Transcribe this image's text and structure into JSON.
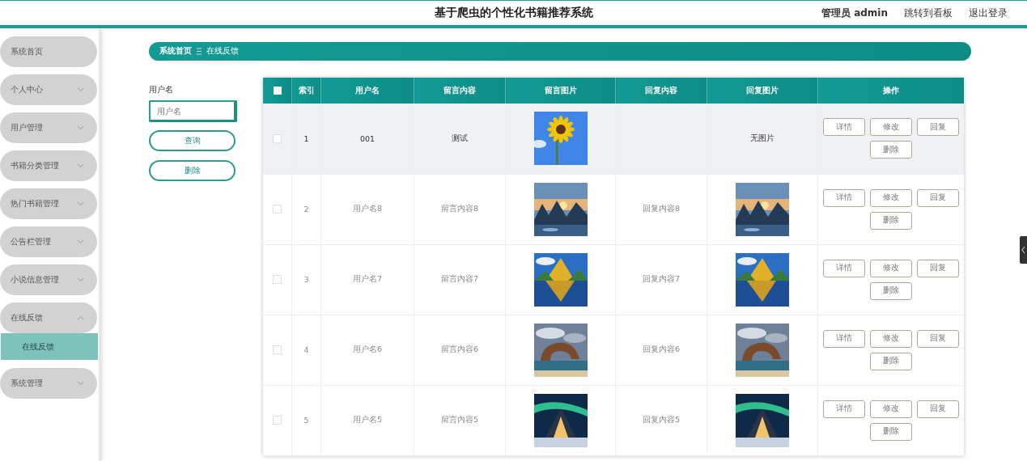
{
  "header": {
    "title": "基于爬虫的个性化书籍推荐系统",
    "links": [
      "管理员 admin",
      "跳转到看板",
      "退出登录"
    ]
  },
  "sidebar": {
    "items": [
      {
        "label": "系统首页",
        "has_children": false
      },
      {
        "label": "个人中心",
        "has_children": true,
        "expanded": false
      },
      {
        "label": "用户管理",
        "has_children": true,
        "expanded": false
      },
      {
        "label": "书籍分类管理",
        "has_children": true,
        "expanded": false
      },
      {
        "label": "热门书籍管理",
        "has_children": true,
        "expanded": false
      },
      {
        "label": "公告栏管理",
        "has_children": true,
        "expanded": false
      },
      {
        "label": "小说信息管理",
        "has_children": true,
        "expanded": false
      },
      {
        "label": "在线反馈",
        "has_children": true,
        "expanded": true,
        "children": [
          {
            "label": "在线反馈",
            "selected": true
          }
        ]
      },
      {
        "label": "系统管理",
        "has_children": true,
        "expanded": false
      }
    ]
  },
  "breadcrumb": [
    "系统首页",
    "在线反馈"
  ],
  "search": {
    "label": "用户名",
    "placeholder": "用户名",
    "buttons": [
      "查询",
      "删除"
    ]
  },
  "table": {
    "all_checked": false,
    "columns": [
      "索引",
      "用户名",
      "留言内容",
      "留言图片",
      "回复内容",
      "回复图片",
      "操作"
    ],
    "rows": [
      {
        "checked": false,
        "highlighted": true,
        "index": "1",
        "username": "001",
        "message": "测试",
        "message_image": {
          "kind": "picture"
        },
        "reply": "",
        "reply_image": {
          "kind": "text",
          "text": "无图片"
        },
        "actions": [
          "详情",
          "修改",
          "回复",
          "删除"
        ]
      },
      {
        "checked": false,
        "highlighted": false,
        "index": "2",
        "username": "用户名8",
        "message": "留言内容8",
        "message_image": {
          "kind": "picture"
        },
        "reply": "回复内容8",
        "reply_image": {
          "kind": "picture"
        },
        "actions": [
          "详情",
          "修改",
          "回复",
          "删除"
        ]
      },
      {
        "checked": false,
        "highlighted": false,
        "index": "3",
        "username": "用户名7",
        "message": "留言内容7",
        "message_image": {
          "kind": "picture"
        },
        "reply": "回复内容7",
        "reply_image": {
          "kind": "picture"
        },
        "actions": [
          "详情",
          "修改",
          "回复",
          "删除"
        ]
      },
      {
        "checked": false,
        "highlighted": false,
        "index": "4",
        "username": "用户名6",
        "message": "留言内容6",
        "message_image": {
          "kind": "picture"
        },
        "reply": "回复内容6",
        "reply_image": {
          "kind": "picture"
        },
        "actions": [
          "详情",
          "修改",
          "回复",
          "删除"
        ]
      },
      {
        "checked": false,
        "highlighted": false,
        "index": "5",
        "username": "用户名5",
        "message": "留言内容5",
        "message_image": {
          "kind": "picture"
        },
        "reply": "回复内容5",
        "reply_image": {
          "kind": "picture"
        },
        "actions": [
          "详情",
          "修改",
          "回复",
          "删除"
        ]
      }
    ]
  }
}
